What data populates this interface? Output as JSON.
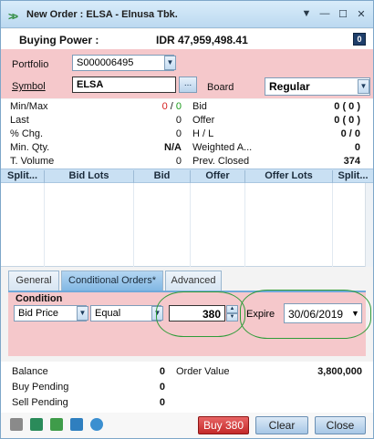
{
  "window": {
    "title": "New Order : ELSA - Elnusa Tbk.",
    "controls": [
      "▼",
      "—",
      "☐",
      "✕"
    ]
  },
  "buying_power": {
    "label": "Buying Power :",
    "value": "IDR 47,959,498.41",
    "info_icon_text": "0"
  },
  "order_form": {
    "portfolio_label": "Portfolio",
    "portfolio_value": "S000006495",
    "symbol_label": "Symbol",
    "symbol_value": "ELSA",
    "board_label": "Board",
    "board_value": "Regular",
    "dots_label": "..."
  },
  "stats": {
    "left": [
      {
        "label": "Min/Max",
        "value_a": "0",
        "sep": " / ",
        "value_b": "0"
      },
      {
        "label": "Last",
        "value": "0"
      },
      {
        "label": "% Chg.",
        "value": "0"
      },
      {
        "label": "Min. Qty.",
        "value": "N/A"
      },
      {
        "label": "T. Volume",
        "value": "0"
      }
    ],
    "right": [
      {
        "label": "Bid",
        "value": "0 ( 0 )"
      },
      {
        "label": "Offer",
        "value": "0 ( 0 )"
      },
      {
        "label": "H / L",
        "value": "0 / 0"
      },
      {
        "label": "Weighted A...",
        "value": "0"
      },
      {
        "label": "Prev. Closed",
        "value": "374"
      }
    ],
    "colors": {
      "green": "#1a9b1a",
      "red": "#d62020"
    }
  },
  "depth_table": {
    "columns": [
      "Split...",
      "Bid Lots",
      "Bid",
      "Offer",
      "Offer Lots",
      "Split..."
    ]
  },
  "tabs": [
    {
      "label": "General",
      "active": false
    },
    {
      "label": "Conditional Orders*",
      "active": true
    },
    {
      "label": "Advanced",
      "active": false
    }
  ],
  "condition": {
    "title": "Condition",
    "field_value": "Bid Price",
    "operator_value": "Equal",
    "price_value": "380",
    "expire_label": "Expire",
    "expire_value": "30/06/2019"
  },
  "summary": {
    "balance_label": "Balance",
    "balance_value": "0",
    "order_value_label": "Order Value",
    "order_value": "3,800,000",
    "buy_pending_label": "Buy Pending",
    "buy_pending_value": "0",
    "sell_pending_label": "Sell Pending",
    "sell_pending_value": "0"
  },
  "footer": {
    "icons": [
      "print-icon",
      "calculator-icon",
      "table-icon",
      "chart-icon",
      "clock-icon"
    ],
    "buy_label": "Buy 380",
    "clear_label": "Clear",
    "close_label": "Close"
  }
}
